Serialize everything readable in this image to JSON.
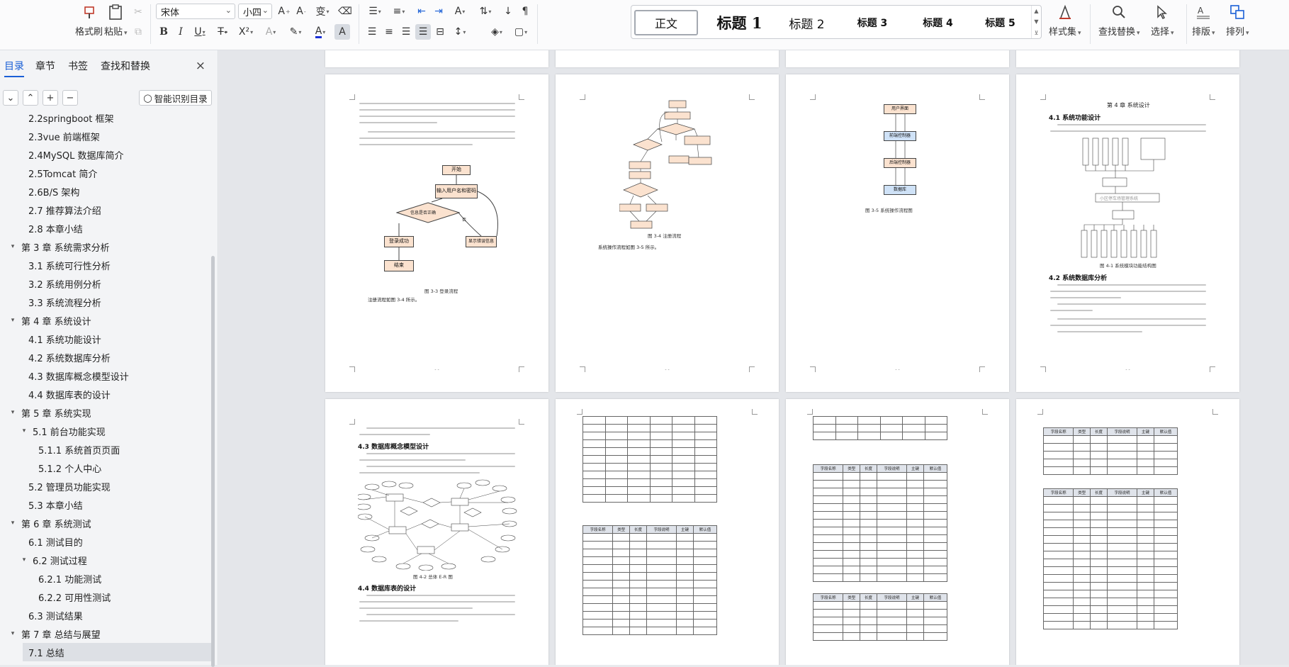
{
  "ribbon": {
    "format_painter": "格式刷",
    "paste": "粘贴",
    "font_name": "宋体",
    "font_size": "小四",
    "styles": {
      "normal": "正文",
      "h1": "标题 1",
      "h2": "标题 2",
      "h3": "标题 3",
      "h4": "标题 4",
      "h5": "标题 5"
    },
    "style_set": "样式集",
    "find_replace": "查找替换",
    "select": "选择",
    "layout": "排版",
    "arrange": "排列"
  },
  "nav": {
    "tabs": [
      "目录",
      "章节",
      "书签",
      "查找和替换"
    ],
    "close": "×",
    "smart_button": "智能识别目录",
    "items": [
      {
        "label": "2.2springboot 框架",
        "level": 2,
        "expander": ""
      },
      {
        "label": "2.3vue 前端框架",
        "level": 2,
        "expander": ""
      },
      {
        "label": "2.4MySQL 数据库简介",
        "level": 2,
        "expander": ""
      },
      {
        "label": "2.5Tomcat 简介",
        "level": 2,
        "expander": ""
      },
      {
        "label": "2.6B/S 架构",
        "level": 2,
        "expander": ""
      },
      {
        "label": "2.7 推荐算法介绍",
        "level": 2,
        "expander": ""
      },
      {
        "label": "2.8 本章小结",
        "level": 2,
        "expander": ""
      },
      {
        "label": "第 3 章  系统需求分析",
        "level": 1,
        "expander": "▾"
      },
      {
        "label": "3.1 系统可行性分析",
        "level": 2,
        "expander": ""
      },
      {
        "label": "3.2 系统用例分析",
        "level": 2,
        "expander": ""
      },
      {
        "label": "3.3 系统流程分析",
        "level": 2,
        "expander": ""
      },
      {
        "label": "第 4 章  系统设计",
        "level": 1,
        "expander": "▾"
      },
      {
        "label": "4.1 系统功能设计",
        "level": 2,
        "expander": ""
      },
      {
        "label": "4.2 系统数据库分析",
        "level": 2,
        "expander": ""
      },
      {
        "label": "4.3 数据库概念模型设计",
        "level": 2,
        "expander": ""
      },
      {
        "label": "4.4 数据库表的设计",
        "level": 2,
        "expander": ""
      },
      {
        "label": "第 5 章  系统实现",
        "level": 1,
        "expander": "▾"
      },
      {
        "label": "5.1 前台功能实现",
        "level": 2,
        "expander": "▾"
      },
      {
        "label": "5.1.1 系统首页页面",
        "level": 3,
        "expander": ""
      },
      {
        "label": "5.1.2 个人中心",
        "level": 3,
        "expander": ""
      },
      {
        "label": "5.2 管理员功能实现",
        "level": 2,
        "expander": ""
      },
      {
        "label": "5.3 本章小结",
        "level": 2,
        "expander": ""
      },
      {
        "label": "第 6 章  系统测试",
        "level": 1,
        "expander": "▾"
      },
      {
        "label": "6.1 测试目的",
        "level": 2,
        "expander": ""
      },
      {
        "label": "6.2 测试过程",
        "level": 2,
        "expander": "▾"
      },
      {
        "label": "6.2.1 功能测试",
        "level": 3,
        "expander": ""
      },
      {
        "label": "6.2.2 可用性测试",
        "level": 3,
        "expander": ""
      },
      {
        "label": "6.3 测试结果",
        "level": 2,
        "expander": ""
      },
      {
        "label": "第 7 章  总结与展望",
        "level": 1,
        "expander": "▾"
      },
      {
        "label": "7.1 总结",
        "level": 2,
        "expander": "",
        "selected": true
      }
    ]
  },
  "pages": {
    "p1": {
      "flow": {
        "start": "开始",
        "input": "输入用户名和密码",
        "decision": "信息是否正确",
        "no": "否",
        "success": "登录成功",
        "error": "显示错误信息",
        "end": "结束"
      },
      "caption": "图 3-3 登录流程",
      "after": "注册流程如图 3-4 所示。"
    },
    "p2": {
      "caption": "图 3-4 注册流程",
      "after": "系统操作流程如图 3-5 所示。"
    },
    "p3": {
      "flow": {
        "user": "用户界面",
        "front": "前端控制器",
        "back": "后端控制器",
        "db": "数据库"
      },
      "caption": "图 3-5 系统操作流程图"
    },
    "p4": {
      "chapter": "第 4 章  系统设计",
      "h41": "4.1 系统功能设计",
      "root": "小区停车场管理系统",
      "h42": "4.2 系统数据库分析",
      "caption": "图 4-1 系统模块功能结构图"
    },
    "p5": {
      "h43": "4.3 数据库概念模型设计",
      "h44": "4.4 数据库表的设计",
      "caption": "图 4-2 总体 E-R 图"
    },
    "table_head": [
      "字段名称",
      "类型",
      "长度",
      "字段说明",
      "主键",
      "默认值"
    ]
  }
}
